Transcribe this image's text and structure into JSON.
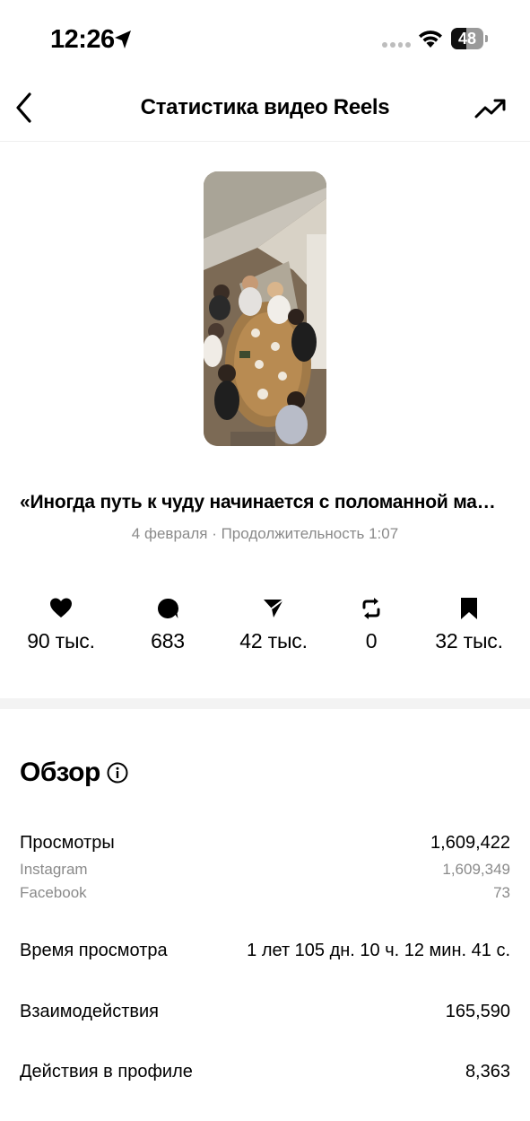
{
  "status_bar": {
    "time": "12:26",
    "battery": "48",
    "battery_level": 0.48
  },
  "header": {
    "title": "Статистика видео Reels"
  },
  "reel": {
    "caption": "«Иногда путь к чуду начинается с поломанной маши...",
    "meta": "4 февраля · Продолжительность 1:07"
  },
  "metrics": [
    {
      "icon": "heart-icon",
      "value": "90 тыс."
    },
    {
      "icon": "comment-icon",
      "value": "683"
    },
    {
      "icon": "share-icon",
      "value": "42 тыс."
    },
    {
      "icon": "repost-icon",
      "value": "0"
    },
    {
      "icon": "bookmark-icon",
      "value": "32 тыс."
    }
  ],
  "overview": {
    "title": "Обзор",
    "views": {
      "label": "Просмотры",
      "value": "1,609,422",
      "instagram_label": "Instagram",
      "instagram_value": "1,609,349",
      "facebook_label": "Facebook",
      "facebook_value": "73"
    },
    "watch_time": {
      "label": "Время просмотра",
      "value": "1 лет 105 дн. 10 ч. 12 мин. 41 с."
    },
    "interactions": {
      "label": "Взаимодействия",
      "value": "165,590"
    },
    "profile_actions": {
      "label": "Действия в профиле",
      "value": "8,363"
    }
  }
}
